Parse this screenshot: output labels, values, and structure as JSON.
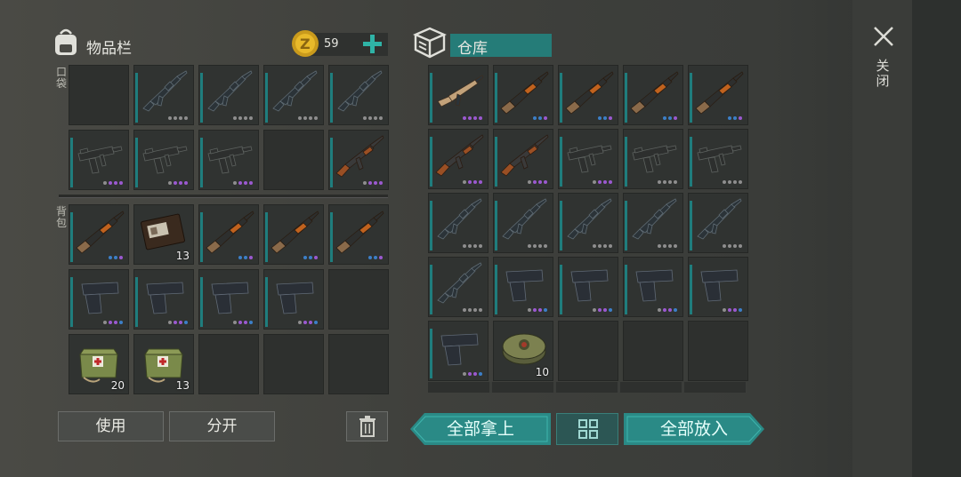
{
  "inventory": {
    "title": "物品栏",
    "coins": "59",
    "pocket_label": "口袋",
    "backpack_label": "背包",
    "pocket_slots": [
      {
        "icon": "empty",
        "count": "",
        "dots": []
      },
      {
        "icon": "m16-rifle-icon",
        "count": "",
        "dots": [
          "#8e8e8e",
          "#8e8e8e",
          "#8e8e8e",
          "#8e8e8e"
        ]
      },
      {
        "icon": "m16-rifle-icon",
        "count": "",
        "dots": [
          "#8e8e8e",
          "#8e8e8e",
          "#8e8e8e",
          "#8e8e8e"
        ]
      },
      {
        "icon": "m16-rifle-icon",
        "count": "",
        "dots": [
          "#8e8e8e",
          "#8e8e8e",
          "#8e8e8e",
          "#8e8e8e"
        ]
      },
      {
        "icon": "m16-rifle-icon",
        "count": "",
        "dots": [
          "#8e8e8e",
          "#8e8e8e",
          "#8e8e8e",
          "#8e8e8e"
        ]
      },
      {
        "icon": "uzi-icon",
        "count": "",
        "dots": [
          "#8e8e8e",
          "#9b59d0",
          "#9b59d0",
          "#9b59d0"
        ]
      },
      {
        "icon": "uzi-icon",
        "count": "",
        "dots": [
          "#8e8e8e",
          "#9b59d0",
          "#9b59d0",
          "#9b59d0"
        ]
      },
      {
        "icon": "uzi-icon",
        "count": "",
        "dots": [
          "#8e8e8e",
          "#9b59d0",
          "#9b59d0",
          "#9b59d0"
        ]
      },
      {
        "icon": "empty",
        "count": "",
        "dots": []
      },
      {
        "icon": "ak-rifle-icon",
        "count": "",
        "dots": [
          "#8e8e8e",
          "#9b59d0",
          "#9b59d0",
          "#9b59d0"
        ]
      }
    ],
    "backpack_slots": [
      {
        "icon": "shotgun-icon",
        "count": "",
        "dots": [
          "#3c7fc8",
          "#3c7fc8",
          "#9b59d0"
        ]
      },
      {
        "icon": "wallet-icon",
        "count": "13",
        "dots": []
      },
      {
        "icon": "shotgun-icon",
        "count": "",
        "dots": [
          "#3c7fc8",
          "#3c7fc8",
          "#9b59d0"
        ]
      },
      {
        "icon": "shotgun-icon",
        "count": "",
        "dots": [
          "#3c7fc8",
          "#3c7fc8",
          "#9b59d0"
        ]
      },
      {
        "icon": "shotgun-icon",
        "count": "",
        "dots": [
          "#3c7fc8",
          "#3c7fc8",
          "#9b59d0"
        ]
      },
      {
        "icon": "pistol-icon",
        "count": "",
        "dots": [
          "#8e8e8e",
          "#9b59d0",
          "#9b59d0",
          "#3c7fc8"
        ]
      },
      {
        "icon": "pistol-icon",
        "count": "",
        "dots": [
          "#8e8e8e",
          "#9b59d0",
          "#9b59d0",
          "#3c7fc8"
        ]
      },
      {
        "icon": "pistol-icon",
        "count": "",
        "dots": [
          "#8e8e8e",
          "#9b59d0",
          "#9b59d0",
          "#3c7fc8"
        ]
      },
      {
        "icon": "pistol-icon",
        "count": "",
        "dots": [
          "#8e8e8e",
          "#9b59d0",
          "#9b59d0",
          "#3c7fc8"
        ]
      },
      {
        "icon": "empty",
        "count": "",
        "dots": []
      },
      {
        "icon": "medkit-icon",
        "count": "20",
        "dots": []
      },
      {
        "icon": "medkit-icon",
        "count": "13",
        "dots": []
      },
      {
        "icon": "empty",
        "count": "",
        "dots": []
      },
      {
        "icon": "empty",
        "count": "",
        "dots": []
      },
      {
        "icon": "empty",
        "count": "",
        "dots": []
      }
    ],
    "use_label": "使用",
    "split_label": "分开"
  },
  "warehouse": {
    "title": "仓库",
    "slots": [
      {
        "icon": "scar-rifle-icon",
        "count": "",
        "dots": [
          "#9b59d0",
          "#9b59d0",
          "#9b59d0",
          "#9b59d0"
        ]
      },
      {
        "icon": "shotgun-icon",
        "count": "",
        "dots": [
          "#3c7fc8",
          "#3c7fc8",
          "#9b59d0"
        ]
      },
      {
        "icon": "shotgun-icon",
        "count": "",
        "dots": [
          "#3c7fc8",
          "#3c7fc8",
          "#9b59d0"
        ]
      },
      {
        "icon": "shotgun-icon",
        "count": "",
        "dots": [
          "#3c7fc8",
          "#3c7fc8",
          "#9b59d0"
        ]
      },
      {
        "icon": "shotgun-icon",
        "count": "",
        "dots": [
          "#3c7fc8",
          "#3c7fc8",
          "#9b59d0"
        ]
      },
      {
        "icon": "ak-rifle-icon",
        "count": "",
        "dots": [
          "#8e8e8e",
          "#9b59d0",
          "#9b59d0",
          "#9b59d0"
        ]
      },
      {
        "icon": "ak-rifle-icon",
        "count": "",
        "dots": [
          "#8e8e8e",
          "#9b59d0",
          "#9b59d0",
          "#9b59d0"
        ]
      },
      {
        "icon": "uzi-icon",
        "count": "",
        "dots": [
          "#8e8e8e",
          "#9b59d0",
          "#9b59d0",
          "#9b59d0"
        ]
      },
      {
        "icon": "uzi-icon",
        "count": "",
        "dots": [
          "#8e8e8e",
          "#8e8e8e",
          "#8e8e8e",
          "#8e8e8e"
        ]
      },
      {
        "icon": "uzi-icon",
        "count": "",
        "dots": [
          "#8e8e8e",
          "#8e8e8e",
          "#8e8e8e",
          "#8e8e8e"
        ]
      },
      {
        "icon": "m16-rifle-icon",
        "count": "",
        "dots": [
          "#8e8e8e",
          "#8e8e8e",
          "#8e8e8e",
          "#8e8e8e"
        ]
      },
      {
        "icon": "m16-rifle-icon",
        "count": "",
        "dots": [
          "#8e8e8e",
          "#8e8e8e",
          "#8e8e8e",
          "#8e8e8e"
        ]
      },
      {
        "icon": "m16-rifle-icon",
        "count": "",
        "dots": [
          "#8e8e8e",
          "#8e8e8e",
          "#8e8e8e",
          "#8e8e8e"
        ]
      },
      {
        "icon": "m16-rifle-icon",
        "count": "",
        "dots": [
          "#8e8e8e",
          "#8e8e8e",
          "#8e8e8e",
          "#8e8e8e"
        ]
      },
      {
        "icon": "m16-rifle-icon",
        "count": "",
        "dots": [
          "#8e8e8e",
          "#8e8e8e",
          "#8e8e8e",
          "#8e8e8e"
        ]
      },
      {
        "icon": "m16-rifle-icon",
        "count": "",
        "dots": [
          "#8e8e8e",
          "#8e8e8e",
          "#8e8e8e",
          "#8e8e8e"
        ]
      },
      {
        "icon": "pistol-icon",
        "count": "",
        "dots": [
          "#8e8e8e",
          "#9b59d0",
          "#9b59d0",
          "#3c7fc8"
        ]
      },
      {
        "icon": "pistol-icon",
        "count": "",
        "dots": [
          "#8e8e8e",
          "#9b59d0",
          "#9b59d0",
          "#3c7fc8"
        ]
      },
      {
        "icon": "pistol-icon",
        "count": "",
        "dots": [
          "#8e8e8e",
          "#9b59d0",
          "#9b59d0",
          "#3c7fc8"
        ]
      },
      {
        "icon": "pistol-icon",
        "count": "",
        "dots": [
          "#8e8e8e",
          "#9b59d0",
          "#9b59d0",
          "#3c7fc8"
        ]
      },
      {
        "icon": "pistol-icon",
        "count": "",
        "dots": [
          "#8e8e8e",
          "#9b59d0",
          "#9b59d0",
          "#3c7fc8"
        ]
      },
      {
        "icon": "landmine-icon",
        "count": "10",
        "dots": []
      },
      {
        "icon": "empty",
        "count": "",
        "dots": []
      },
      {
        "icon": "empty",
        "count": "",
        "dots": []
      },
      {
        "icon": "empty",
        "count": "",
        "dots": []
      }
    ],
    "take_all_label": "全部拿上",
    "put_all_label": "全部放入"
  },
  "close_label": "关闭",
  "colors": {
    "accent": "#2a8a86",
    "rarity_bar": "#1f7d7d"
  }
}
